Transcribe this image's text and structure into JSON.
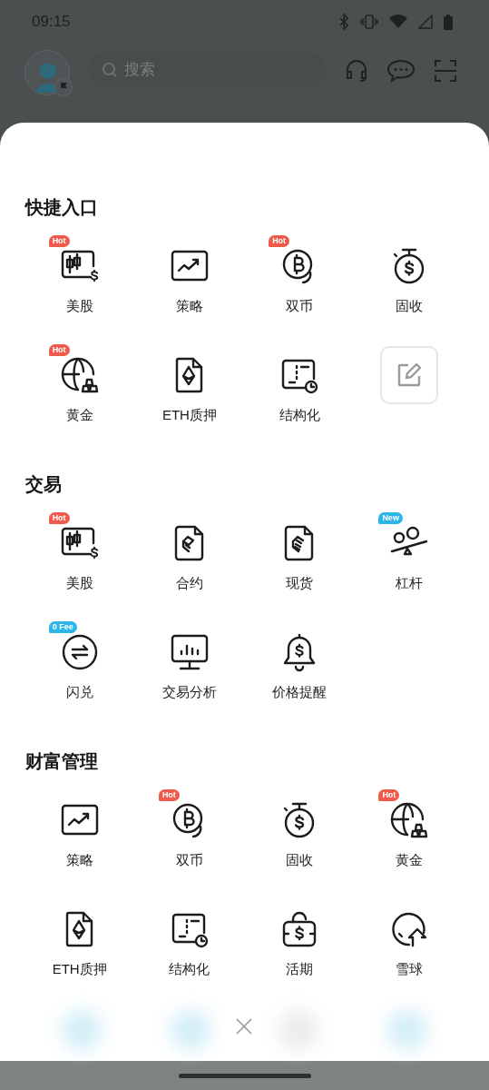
{
  "status_bar": {
    "time": "09:15"
  },
  "header": {
    "search": {
      "placeholder": "搜索"
    }
  },
  "sections": [
    {
      "title": "快捷入口",
      "items": [
        {
          "kind": "stocks",
          "label": "美股",
          "badge": {
            "text": "Hot",
            "color": "#ef5a4c"
          }
        },
        {
          "kind": "strategy",
          "label": "策略"
        },
        {
          "kind": "dual",
          "label": "双币",
          "badge": {
            "text": "Hot",
            "color": "#ef5a4c"
          }
        },
        {
          "kind": "fixed",
          "label": "固收"
        },
        {
          "kind": "gold",
          "label": "黄金",
          "badge": {
            "text": "Hot",
            "color": "#ef5a4c"
          }
        },
        {
          "kind": "eth",
          "label": "ETH质押"
        },
        {
          "kind": "structured",
          "label": "结构化"
        },
        {
          "kind": "edit"
        }
      ]
    },
    {
      "title": "交易",
      "items": [
        {
          "kind": "stocks",
          "label": "美股",
          "badge": {
            "text": "Hot",
            "color": "#ef5a4c"
          }
        },
        {
          "kind": "contract",
          "label": "合约"
        },
        {
          "kind": "spot",
          "label": "现货"
        },
        {
          "kind": "margin",
          "label": "杠杆",
          "badge": {
            "text": "New",
            "color": "#2bb5e8"
          }
        },
        {
          "kind": "swap",
          "label": "闪兑",
          "badge": {
            "text": "0 Fee",
            "color": "#2bb5e8"
          }
        },
        {
          "kind": "analysis",
          "label": "交易分析"
        },
        {
          "kind": "alert",
          "label": "价格提醒"
        }
      ]
    },
    {
      "title": "财富管理",
      "items": [
        {
          "kind": "strategy",
          "label": "策略"
        },
        {
          "kind": "dual",
          "label": "双币",
          "badge": {
            "text": "Hot",
            "color": "#ef5a4c"
          }
        },
        {
          "kind": "fixed",
          "label": "固收"
        },
        {
          "kind": "gold",
          "label": "黄金",
          "badge": {
            "text": "Hot",
            "color": "#ef5a4c"
          }
        },
        {
          "kind": "eth",
          "label": "ETH质押"
        },
        {
          "kind": "structured",
          "label": "结构化"
        },
        {
          "kind": "flexible",
          "label": "活期"
        },
        {
          "kind": "snowball",
          "label": "雪球"
        }
      ]
    }
  ]
}
